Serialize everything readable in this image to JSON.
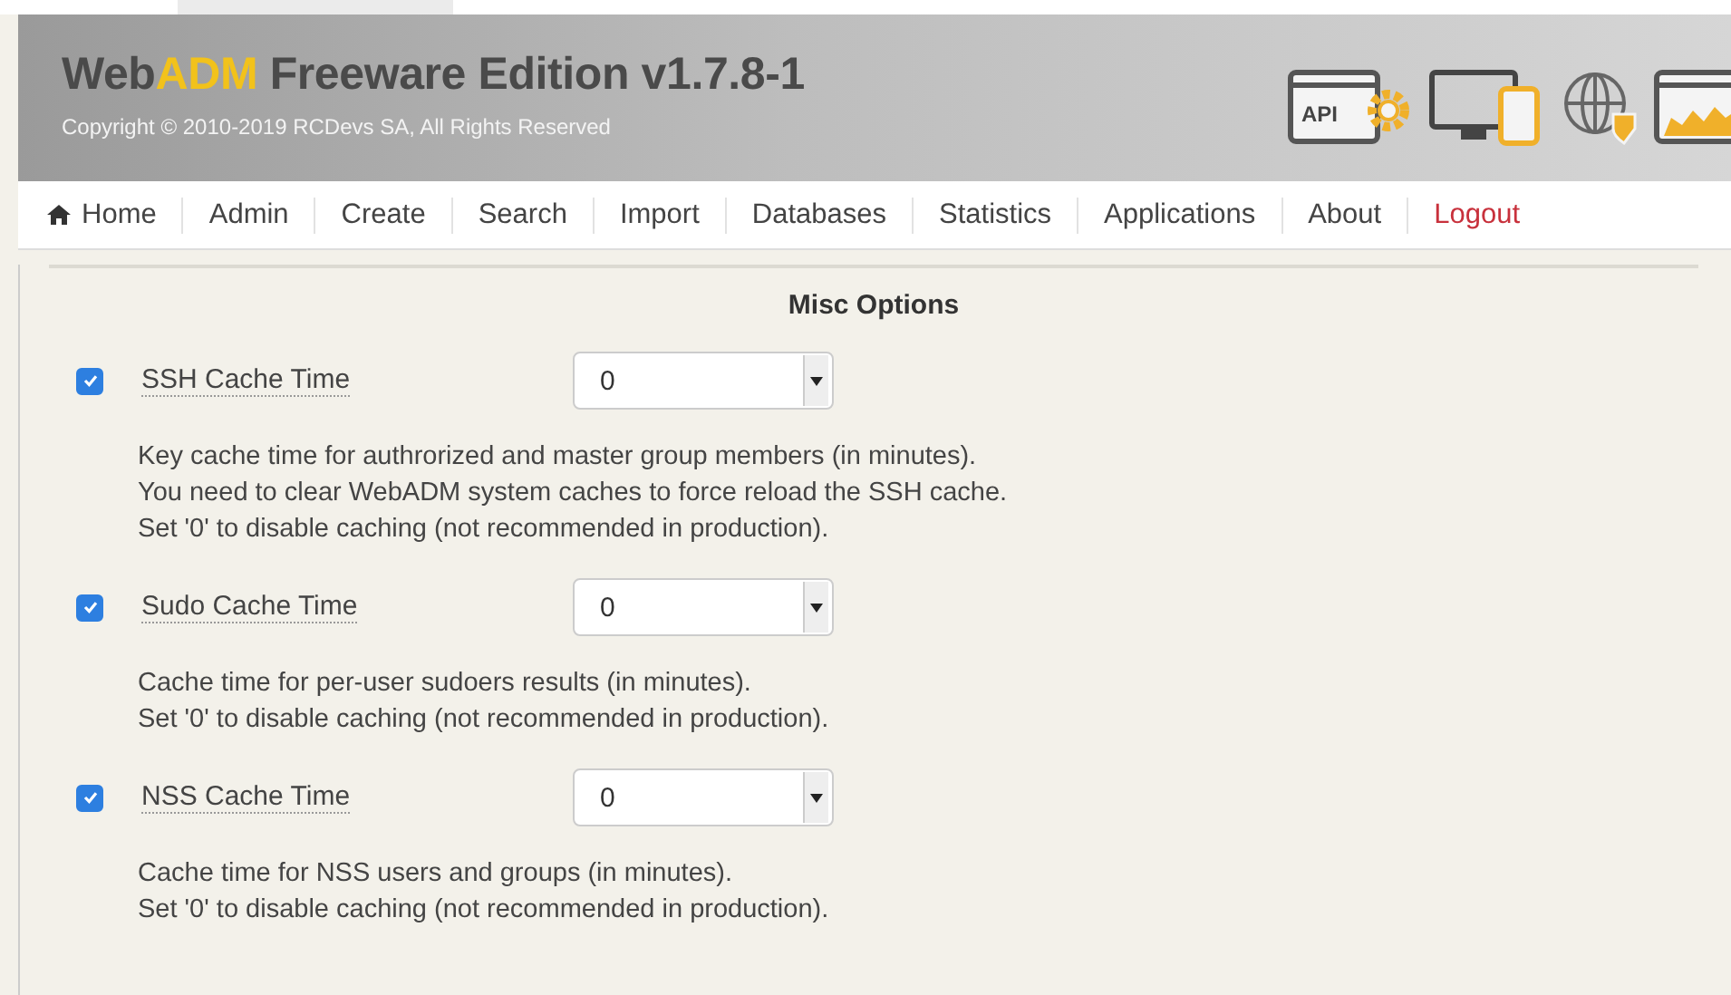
{
  "header": {
    "title_parts": [
      {
        "text": "Web",
        "accent": false
      },
      {
        "text": "ADM",
        "accent": true
      },
      {
        "text": " Freeware Edition v1.7.8-1",
        "accent": false
      }
    ],
    "copyright": "Copyright © 2010-2019 RCDevs SA, All Rights Reserved",
    "api_icon_label": "API"
  },
  "nav": [
    {
      "label": "Home",
      "kind": "home"
    },
    {
      "label": "Admin",
      "kind": "link"
    },
    {
      "label": "Create",
      "kind": "link"
    },
    {
      "label": "Search",
      "kind": "link"
    },
    {
      "label": "Import",
      "kind": "link"
    },
    {
      "label": "Databases",
      "kind": "link"
    },
    {
      "label": "Statistics",
      "kind": "link"
    },
    {
      "label": "Applications",
      "kind": "link"
    },
    {
      "label": "About",
      "kind": "link"
    },
    {
      "label": "Logout",
      "kind": "logout"
    }
  ],
  "section_title": "Misc Options",
  "options": [
    {
      "label": "SSH Cache Time",
      "checked": true,
      "value": "0",
      "description": [
        "Key cache time for authrorized and master group members (in minutes).",
        "You need to clear WebADM system caches to force reload the SSH cache.",
        "Set '0' to disable caching (not recommended in production)."
      ]
    },
    {
      "label": "Sudo Cache Time",
      "checked": true,
      "value": "0",
      "description": [
        "Cache time for per-user sudoers results (in minutes).",
        "Set '0' to disable caching (not recommended in production)."
      ]
    },
    {
      "label": "NSS Cache Time",
      "checked": true,
      "value": "0",
      "description": [
        "Cache time for NSS users and groups (in minutes).",
        "Set '0' to disable caching (not recommended in production)."
      ]
    }
  ]
}
